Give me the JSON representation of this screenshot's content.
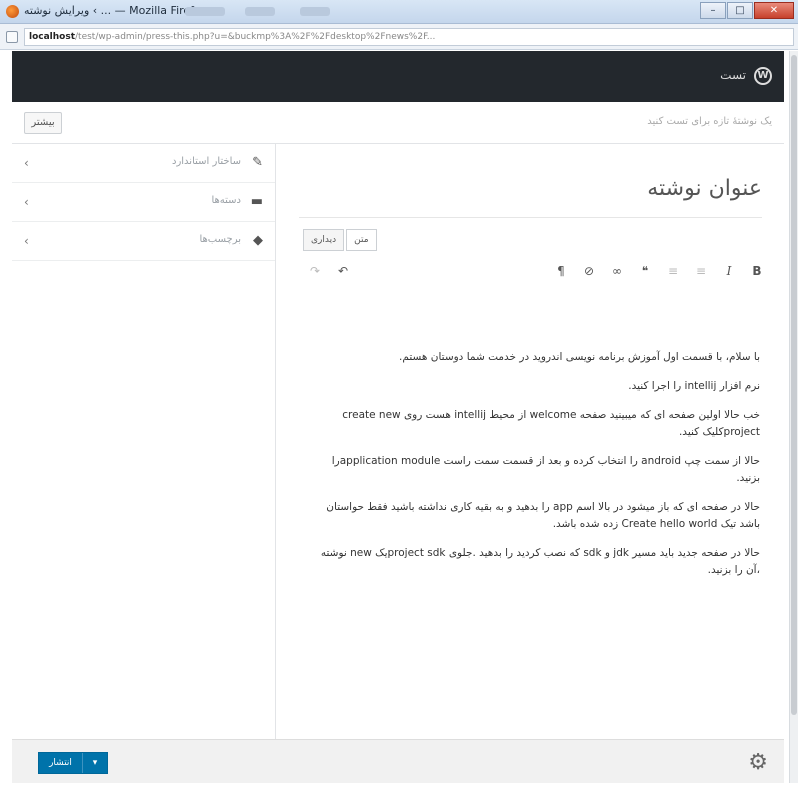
{
  "window": {
    "title": "ویرایش نوشته ‹ ... — Mozilla Firefox",
    "controls": {
      "minimize": "–",
      "maximize": "□",
      "close": "✕"
    }
  },
  "address": {
    "host": "localhost",
    "rest": "/test/wp-admin/press-this.php?u=&buckmp%3A%2F%2Fdesktop%2Fnews%2F..."
  },
  "adminbar": {
    "logo_icon": "wordpress-logo-icon",
    "label": "تست"
  },
  "notice": {
    "text": "یک نوشتهٔ تازه برای تست کنید",
    "back_label": "بیشتر"
  },
  "sidebar": {
    "items": [
      {
        "icon": "pin-icon",
        "glyph": "📌",
        "label": "ساختار استاندارد"
      },
      {
        "icon": "folder-icon",
        "glyph": "📁",
        "label": "دسته‌ها"
      },
      {
        "icon": "tag-icon",
        "glyph": "🏷",
        "label": "برچسب‌ها"
      }
    ]
  },
  "editor": {
    "title": "عنوان نوشته",
    "tabs": [
      "دیداری",
      "متن"
    ],
    "toolbar": {
      "bold": "B",
      "italic": "I",
      "ul": "☰",
      "ol": "☰",
      "quote": "❝",
      "link": "🔗",
      "unlink": "⛓",
      "paragraph": "¶",
      "redo": "↷",
      "undo": "↶"
    },
    "paragraphs": [
      "با سلام، با قسمت اول آموزش برنامه نویسی اندروید در خدمت شما دوستان هستم.",
      "نرم افزار intellij را اجرا کنید.",
      "خب حالا اولین صفحه ای که میبینید صفحه welcome از محیط intellij هست روی create new projectکلیک کنید.",
      "حالا از سمت چپ android را انتخاب کرده و بعد از قسمت سمت راست application moduleرا بزنید.",
      "حالا در صفحه ای که باز میشود در بالا اسم app را بدهید و به بقیه کاری نداشته باشید فقط حواستان باشد تیک Create hello world زده شده باشد.",
      "حالا در صفحه جدید باید مسیر jdk و sdk که نصب کردید را بدهید .جلوی project sdkیک new نوشته ،آن را بزنید."
    ]
  },
  "footer": {
    "publish_label": "انتشار",
    "dropdown_icon": "▾",
    "icon": "settings-icon",
    "icon_glyph": "⚙"
  }
}
